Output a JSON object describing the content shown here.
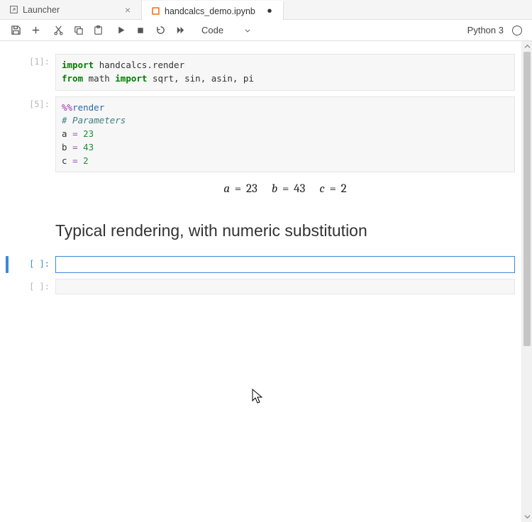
{
  "tabs": [
    {
      "label": "Launcher",
      "active": false,
      "dirty": false,
      "icon": "launcher"
    },
    {
      "label": "handcalcs_demo.ipynb",
      "active": true,
      "dirty": true,
      "icon": "notebook"
    }
  ],
  "toolbar": {
    "cell_type_label": "Code"
  },
  "kernel": {
    "name": "Python 3"
  },
  "cells": [
    {
      "prompt": "[1]:",
      "type": "code",
      "code_tokens": [
        {
          "t": "import ",
          "c": "tok-k"
        },
        {
          "t": "handcalcs.render",
          "c": "tok-nm"
        },
        {
          "t": "\n"
        },
        {
          "t": "from ",
          "c": "tok-k"
        },
        {
          "t": "math ",
          "c": "tok-nm"
        },
        {
          "t": "import ",
          "c": "tok-k"
        },
        {
          "t": "sqrt, sin, asin, pi",
          "c": "tok-nm"
        }
      ]
    },
    {
      "prompt": "[5]:",
      "type": "code",
      "code_tokens": [
        {
          "t": "%%",
          "c": "tok-magic"
        },
        {
          "t": "render",
          "c": "tok-nn"
        },
        {
          "t": "\n"
        },
        {
          "t": "# Parameters",
          "c": "tok-comment"
        },
        {
          "t": "\n"
        },
        {
          "t": "a ",
          "c": "tok-nm"
        },
        {
          "t": "= ",
          "c": "tok-op"
        },
        {
          "t": "23",
          "c": "tok-num"
        },
        {
          "t": "\n"
        },
        {
          "t": "b ",
          "c": "tok-nm"
        },
        {
          "t": "= ",
          "c": "tok-op"
        },
        {
          "t": "43",
          "c": "tok-num"
        },
        {
          "t": "\n"
        },
        {
          "t": "c ",
          "c": "tok-nm"
        },
        {
          "t": "= ",
          "c": "tok-op"
        },
        {
          "t": "2",
          "c": "tok-num"
        }
      ],
      "output": {
        "type": "latex",
        "equations": [
          {
            "var": "a",
            "val": "23"
          },
          {
            "var": "b",
            "val": "43"
          },
          {
            "var": "c",
            "val": "2"
          }
        ]
      }
    },
    {
      "prompt": "",
      "type": "markdown",
      "heading": "Typical rendering, with numeric substitution"
    },
    {
      "prompt": "[ ]:",
      "type": "code",
      "selected": true,
      "code_tokens": []
    },
    {
      "prompt": "[ ]:",
      "type": "code",
      "code_tokens": []
    }
  ]
}
